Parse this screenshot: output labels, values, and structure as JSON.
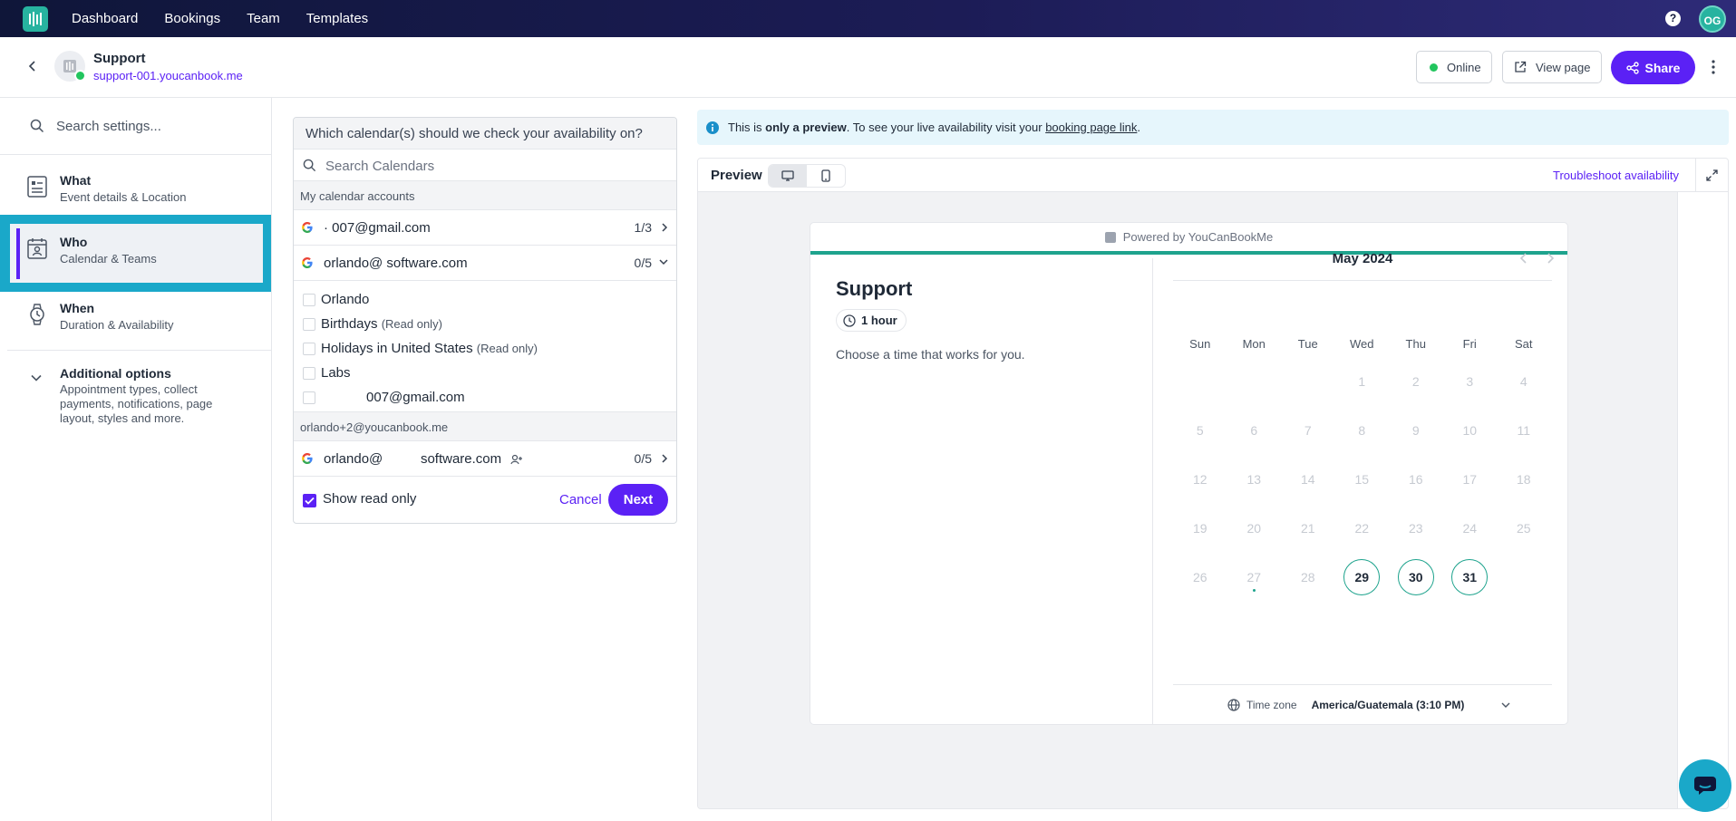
{
  "nav": {
    "items": [
      "Dashboard",
      "Bookings",
      "Team",
      "Templates"
    ],
    "help": "?",
    "avatar": "OG"
  },
  "header": {
    "title": "Support",
    "url": "support-001.youcanbook.me",
    "status": "Online",
    "view_page": "View page",
    "share": "Share"
  },
  "sidebar": {
    "search_placeholder": "Search settings...",
    "items": [
      {
        "title": "What",
        "sub": "Event details & Location"
      },
      {
        "title": "Who",
        "sub": "Calendar & Teams"
      },
      {
        "title": "When",
        "sub": "Duration & Availability"
      }
    ],
    "more": {
      "title": "Additional options",
      "desc": "Appointment types, collect payments, notifications, page layout, styles and more."
    }
  },
  "calendars": {
    "question": "Which calendar(s) should we check your availability on?",
    "search_placeholder": "Search Calendars",
    "section1": "My calendar accounts",
    "accounts": [
      {
        "email": "·          007@gmail.com",
        "count": "1/3"
      },
      {
        "email": "orlando@          software.com",
        "count": "0/5"
      }
    ],
    "subcals": [
      {
        "name": "Orlando",
        "note": ""
      },
      {
        "name": "Birthdays",
        "note": "(Read only)"
      },
      {
        "name": "Holidays in United States",
        "note": "(Read only)"
      },
      {
        "name": "Labs",
        "note": ""
      },
      {
        "name": "            007@gmail.com",
        "note": ""
      }
    ],
    "section2": "orlando+2@youcanbook.me",
    "team_account": {
      "email": "orlando@          software.com",
      "count": "0/5"
    },
    "show_read_only": "Show read only",
    "cancel": "Cancel",
    "next": "Next"
  },
  "banner": {
    "text_pre": "This is ",
    "text_bold": "only a preview",
    "text_mid": ". To see your live availability visit your ",
    "link": "booking page link",
    "text_end": "."
  },
  "preview": {
    "label": "Preview",
    "troubleshoot": "Troubleshoot availability",
    "powered": "Powered by YouCanBookMe",
    "service_title": "Support",
    "duration": "1 hour",
    "description": "Choose a time that works for you.",
    "month": "May 2024",
    "dows": [
      "Sun",
      "Mon",
      "Tue",
      "Wed",
      "Thu",
      "Fri",
      "Sat"
    ],
    "weeks": [
      [
        "",
        "",
        "",
        "1",
        "2",
        "3",
        "4"
      ],
      [
        "5",
        "6",
        "7",
        "8",
        "9",
        "10",
        "11"
      ],
      [
        "12",
        "13",
        "14",
        "15",
        "16",
        "17",
        "18"
      ],
      [
        "19",
        "20",
        "21",
        "22",
        "23",
        "24",
        "25"
      ],
      [
        "26",
        "27",
        "28",
        "29",
        "30",
        "31",
        ""
      ]
    ],
    "available_days": [
      "29",
      "30",
      "31"
    ],
    "today": "27",
    "timezone_label": "Time zone",
    "timezone_value": "America/Guatemala (3:10 PM)"
  },
  "colors": {
    "accent": "#5b21f5",
    "teal": "#1ea38d",
    "highlight": "#1aa8c9",
    "online": "#22c55e"
  }
}
